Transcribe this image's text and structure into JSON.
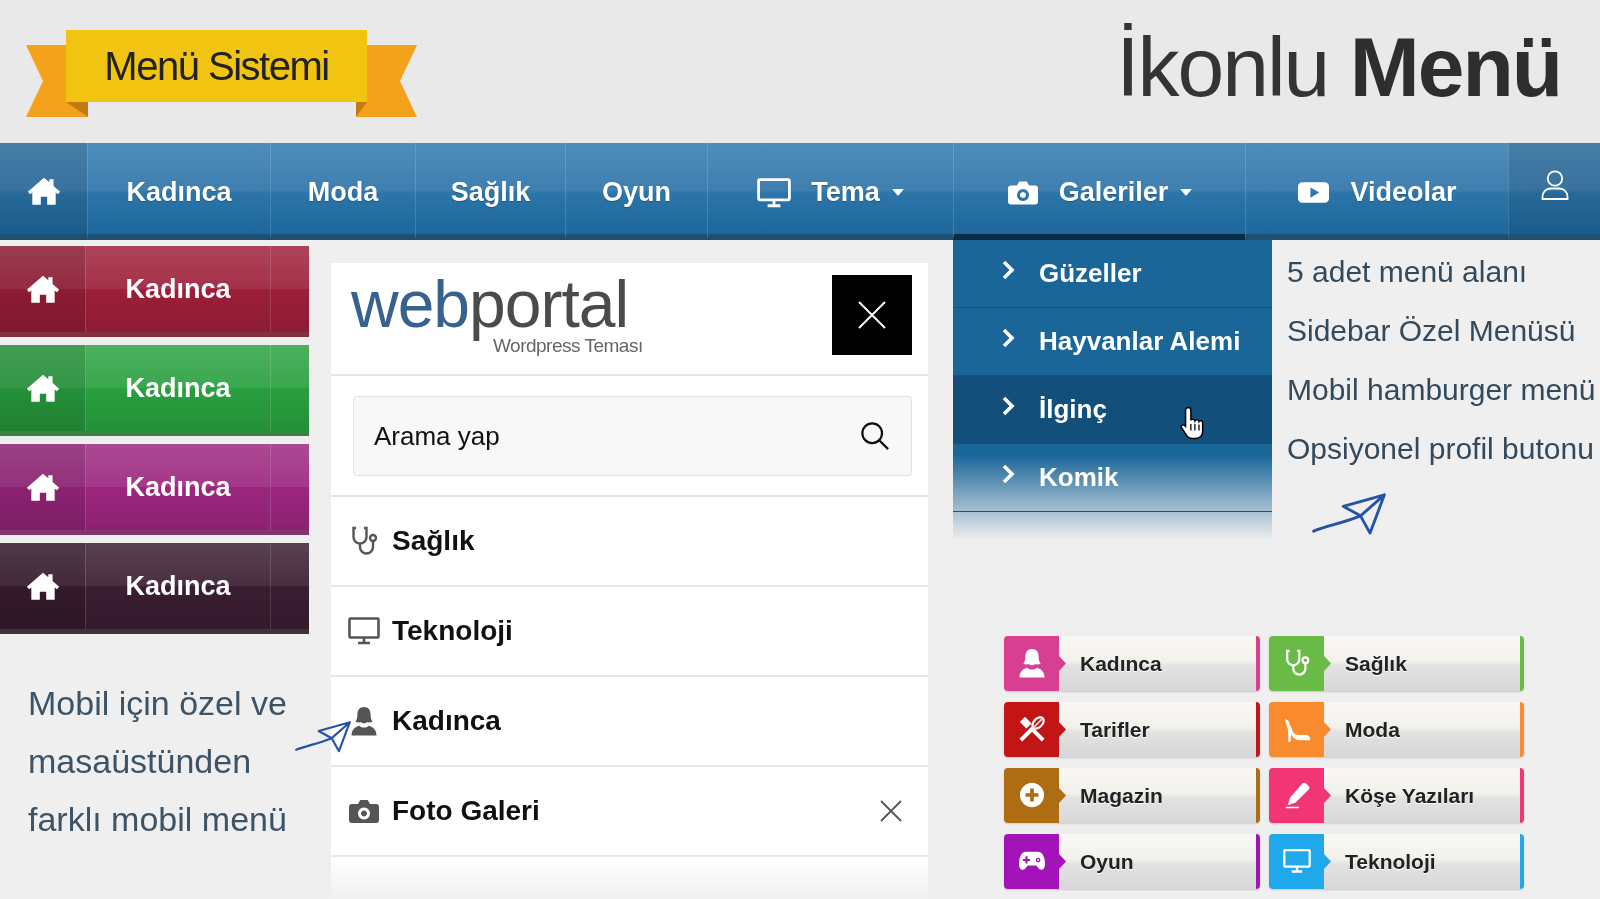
{
  "header": {
    "banner_title": "Menü Sistemi",
    "site_title": "İkonlu **Menü**"
  },
  "nav": {
    "items": [
      {
        "label": "Kadınca",
        "dropdown": false,
        "expanded": false
      },
      {
        "label": "Moda",
        "dropdown": false,
        "expanded": false
      },
      {
        "label": "Sağlık",
        "dropdown": false,
        "expanded": false
      },
      {
        "label": "Oyun",
        "dropdown": false,
        "expanded": false
      },
      {
        "label": "Tema",
        "dropdown": true,
        "expanded": false
      },
      {
        "label": "Galeriler",
        "dropdown": true,
        "expanded": true
      },
      {
        "label": "Videolar",
        "dropdown": false,
        "expanded": false
      }
    ]
  },
  "dropdown": {
    "items": [
      {
        "label": "Güzeller",
        "selected": false
      },
      {
        "label": "Hayvanlar Alemi",
        "selected": false
      },
      {
        "label": "İlginç",
        "selected": true
      },
      {
        "label": "Komik",
        "selected": false
      }
    ]
  },
  "color_menus": [
    {
      "label": "Kadınca",
      "color": "#9d1f3a"
    },
    {
      "label": "Kadınca",
      "color": "#29a03f"
    },
    {
      "label": "Kadınca",
      "color": "#9c267f"
    },
    {
      "label": "Kadınca",
      "color": "#3a1d31"
    }
  ],
  "mobile_note": "Mobil için özel ve masaüstünden farklı mobil menü",
  "mobile_menu": {
    "logo": {
      "text_start": "web",
      "text_end": "portal",
      "tagline": "Wordpress Teması"
    },
    "search": {
      "placeholder": "Arama yap"
    },
    "items": [
      {
        "label": "Sağlık",
        "expanded": false
      },
      {
        "label": "Teknoloji",
        "expanded": false
      },
      {
        "label": "Kadınca",
        "expanded": false
      },
      {
        "label": "Foto Galeri",
        "expanded": true
      }
    ]
  },
  "features": [
    "5 adet menü alanı",
    "Sidebar Özel Menüsü",
    "Mobil hamburger menü",
    "Opsiyonel profil butonu"
  ],
  "category_tiles": [
    {
      "label": "Kadınca",
      "color": "#d83f93"
    },
    {
      "label": "Sağlık",
      "color": "#6aba47"
    },
    {
      "label": "Tarifler",
      "color": "#c31515"
    },
    {
      "label": "Moda",
      "color": "#f98a2e"
    },
    {
      "label": "Magazin",
      "color": "#ae6d12"
    },
    {
      "label": "Köşe Yazıları",
      "color": "#f23675"
    },
    {
      "label": "Oyun",
      "color": "#a314b8"
    },
    {
      "label": "Teknoloji",
      "color": "#1fa9ea"
    }
  ]
}
